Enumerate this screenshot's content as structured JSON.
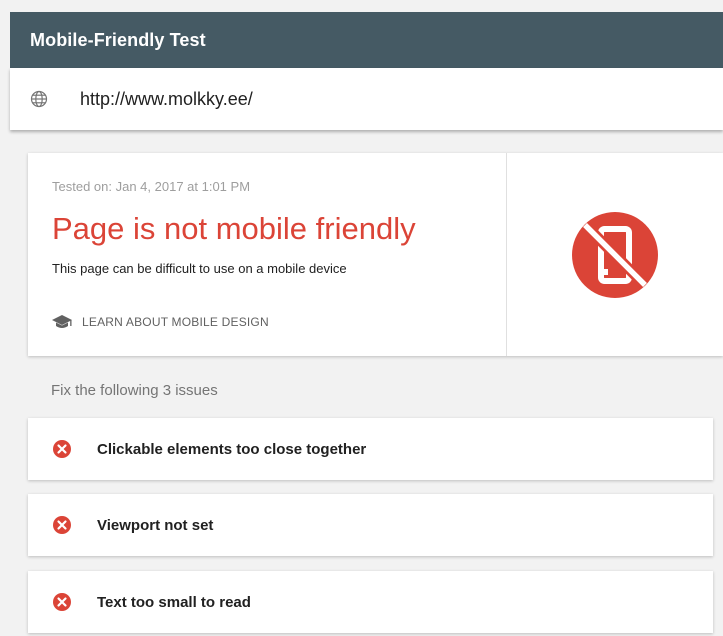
{
  "header": {
    "title": "Mobile-Friendly Test"
  },
  "url_bar": {
    "url": "http://www.molkky.ee/",
    "icon": "globe-icon"
  },
  "result": {
    "tested_on": "Tested on: Jan 4, 2017 at 1:01 PM",
    "headline": "Page is not mobile friendly",
    "description": "This page can be difficult to use on a mobile device",
    "learn_link_label": "LEARN ABOUT MOBILE DESIGN",
    "learn_link_icon": "school-icon",
    "status_icon": "not-mobile-friendly-icon",
    "status_color": "#db4437"
  },
  "issues": {
    "heading": "Fix the following 3 issues",
    "items": [
      {
        "label": "Clickable elements too close together",
        "icon": "error-icon"
      },
      {
        "label": "Viewport not set",
        "icon": "error-icon"
      },
      {
        "label": "Text too small to read",
        "icon": "error-icon"
      }
    ]
  },
  "colors": {
    "header_bg": "#455a64",
    "error_red": "#db4437",
    "muted_text": "#9e9e9e"
  }
}
